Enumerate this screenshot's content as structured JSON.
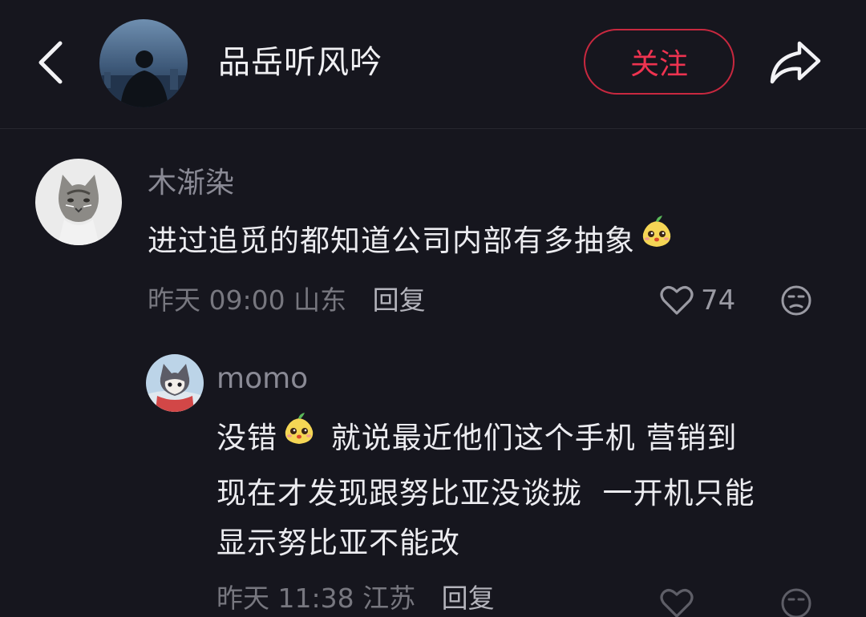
{
  "header": {
    "back_icon": "chevron-left-icon",
    "name": "品岳听风吟",
    "follow_label": "关注",
    "share_icon": "share-arrow-icon",
    "accent": "#ee3350"
  },
  "comments": [
    {
      "user": "木渐染",
      "text": "进过追觅的都知道公司内部有多抽象",
      "emoji": "pear-emoji-icon",
      "time": "昨天 09:00",
      "location": "山东",
      "reply_label": "回复",
      "likes": "74"
    },
    {
      "user": "momo",
      "text_before_emoji": "没错",
      "emoji": "pear-emoji-icon",
      "text_line1_after": " 就说最近他们这个手机 营销到",
      "text_line2": "现在才发现跟努比亚没谈拢  一开机只能",
      "text_line3": "显示努比亚不能改",
      "time": "昨天 11:38",
      "location": "江苏",
      "reply_label": "回复"
    }
  ]
}
